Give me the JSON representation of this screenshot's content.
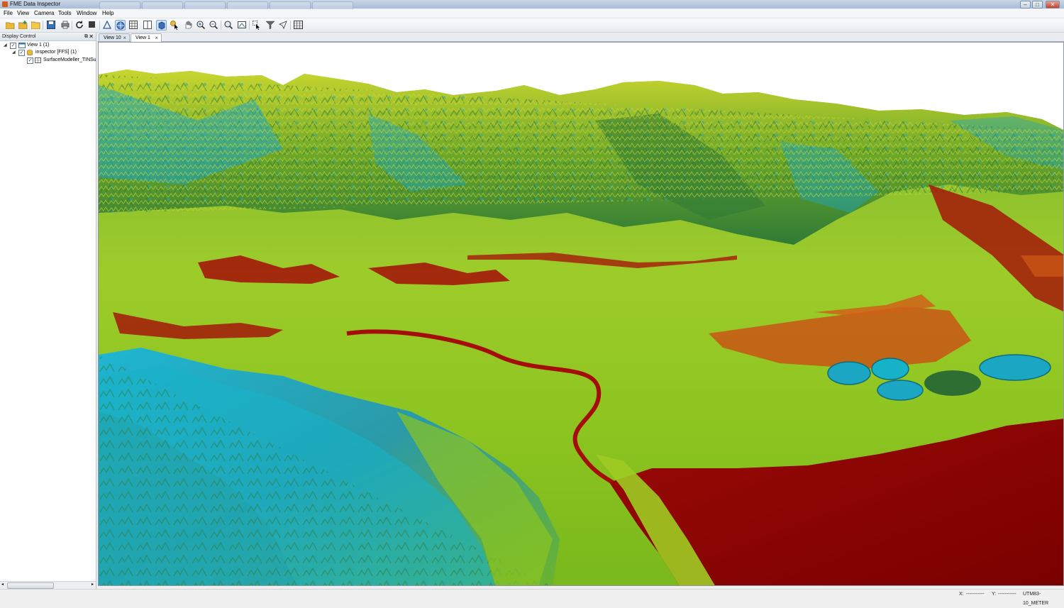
{
  "window": {
    "title": "FME Data Inspector"
  },
  "menu": {
    "items": [
      "File",
      "View",
      "Camera",
      "Tools",
      "Window",
      "Help"
    ]
  },
  "toolbar": {
    "icons": [
      "open-dataset-icon",
      "add-dataset-icon",
      "open-folder-icon",
      "save-icon",
      "print-icon",
      "refresh-icon",
      "stop-icon",
      "draw-style-icon",
      "view-3d-icon",
      "table-view-icon",
      "split-view-icon",
      "orbit-icon",
      "select-pointer-icon",
      "pan-hand-icon",
      "zoom-in-icon",
      "zoom-out-icon",
      "zoom-extent-icon",
      "measure-icon",
      "select-icon",
      "filter-icon",
      "navigate-icon",
      "grid-icon"
    ]
  },
  "display_control": {
    "title": "Display Control",
    "tree": [
      {
        "label": "View 1 (1)",
        "checked": true
      },
      {
        "label": "inspector [FFS] (1)",
        "checked": true
      },
      {
        "label": "SurfaceModeller_TINSu",
        "checked": true
      }
    ]
  },
  "tabs": [
    {
      "label": "View 10",
      "active": false
    },
    {
      "label": "View 1",
      "active": true
    }
  ],
  "status": {
    "x_label": "X:",
    "x_value": "-----------",
    "y_label": "Y:",
    "y_value": "-----------",
    "crs": "UTM83-10_METER"
  },
  "colors": {
    "sky": "#ffffff",
    "low_elevation": "#8b0000",
    "mid_elevation": "#8cc63f",
    "high_elevation": "#17b2c8",
    "ridge": "#2e7d32"
  }
}
